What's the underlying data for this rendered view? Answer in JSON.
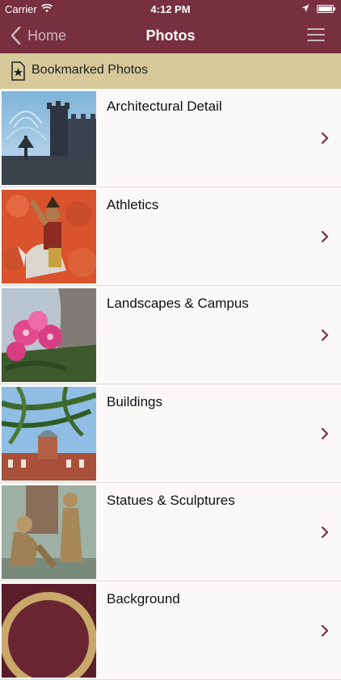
{
  "status_bar": {
    "carrier": "Carrier",
    "time": "4:12 PM"
  },
  "nav": {
    "back_label": "Home",
    "title": "Photos"
  },
  "bookmarked": {
    "label": "Bookmarked Photos"
  },
  "categories": [
    {
      "title": "Architectural Detail"
    },
    {
      "title": "Athletics"
    },
    {
      "title": "Landscapes & Campus"
    },
    {
      "title": "Buildings"
    },
    {
      "title": "Statues & Sculptures"
    },
    {
      "title": "Background"
    }
  ],
  "colors": {
    "brand_garnet": "#782f40",
    "gold": "#d7c99a",
    "arrow": "#782f40"
  },
  "icons": [
    "wifi-icon",
    "location-icon",
    "battery-icon",
    "chevron-left-icon",
    "menu-icon",
    "bookmark-star-icon",
    "chevron-right-icon"
  ]
}
